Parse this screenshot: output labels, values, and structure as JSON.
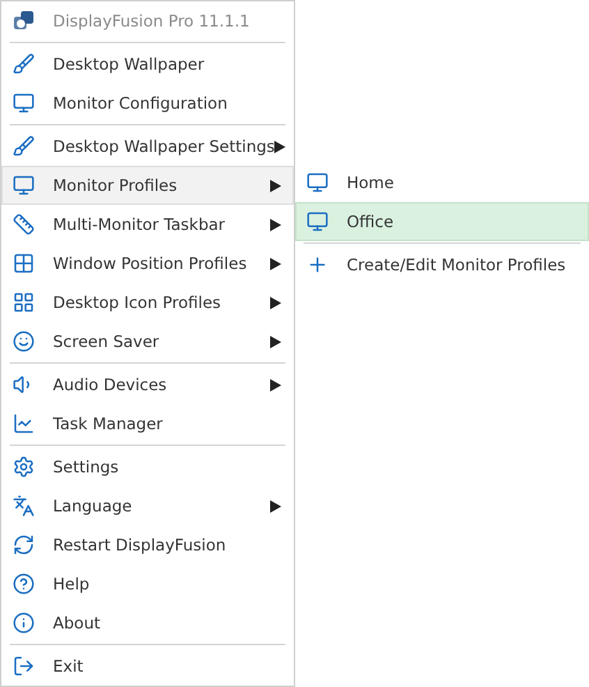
{
  "menu": {
    "items": [
      {
        "kind": "title",
        "label": "DisplayFusion Pro 11.1.1"
      },
      {
        "kind": "separator"
      },
      {
        "kind": "item",
        "label": "Desktop Wallpaper",
        "submenu": false,
        "selected": false
      },
      {
        "kind": "item",
        "label": "Monitor Configuration",
        "submenu": false,
        "selected": false
      },
      {
        "kind": "separator"
      },
      {
        "kind": "item",
        "label": "Desktop Wallpaper Settings",
        "submenu": true,
        "selected": false
      },
      {
        "kind": "item",
        "label": "Monitor Profiles",
        "submenu": true,
        "selected": true
      },
      {
        "kind": "item",
        "label": "Multi-Monitor Taskbar",
        "submenu": true,
        "selected": false
      },
      {
        "kind": "item",
        "label": "Window Position Profiles",
        "submenu": true,
        "selected": false
      },
      {
        "kind": "item",
        "label": "Desktop Icon Profiles",
        "submenu": true,
        "selected": false
      },
      {
        "kind": "item",
        "label": "Screen Saver",
        "submenu": true,
        "selected": false
      },
      {
        "kind": "separator"
      },
      {
        "kind": "item",
        "label": "Audio Devices",
        "submenu": true,
        "selected": false
      },
      {
        "kind": "item",
        "label": "Task Manager",
        "submenu": false,
        "selected": false
      },
      {
        "kind": "separator"
      },
      {
        "kind": "item",
        "label": "Settings",
        "submenu": false,
        "selected": false
      },
      {
        "kind": "item",
        "label": "Language",
        "submenu": true,
        "selected": false
      },
      {
        "kind": "item",
        "label": "Restart DisplayFusion",
        "submenu": false,
        "selected": false
      },
      {
        "kind": "item",
        "label": "Help",
        "submenu": false,
        "selected": false
      },
      {
        "kind": "item",
        "label": "About",
        "submenu": false,
        "selected": false
      },
      {
        "kind": "separator"
      },
      {
        "kind": "item",
        "label": "Exit",
        "submenu": false,
        "selected": false
      }
    ]
  },
  "submenu": {
    "items": [
      {
        "kind": "item",
        "label": "Home",
        "selected": false
      },
      {
        "kind": "item",
        "label": "Office",
        "selected": true
      },
      {
        "kind": "separator"
      },
      {
        "kind": "item",
        "label": "Create/Edit Monitor Profiles",
        "selected": false
      }
    ]
  }
}
